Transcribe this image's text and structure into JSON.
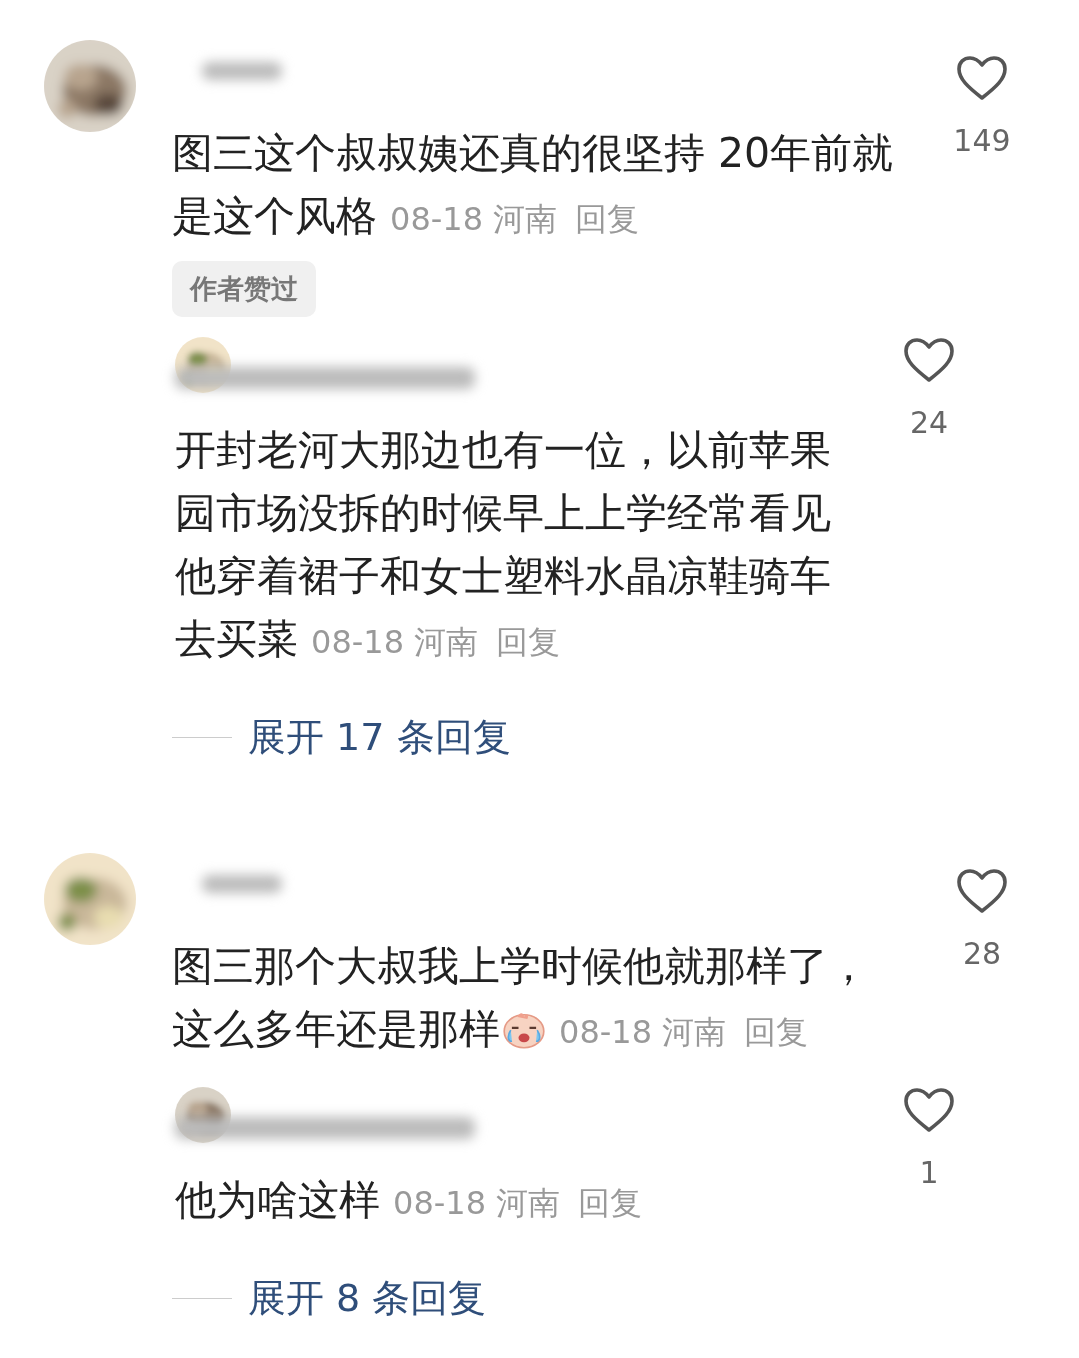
{
  "comments": [
    {
      "text": "图三这个叔叔姨还真的很坚持  20年前就是这个风格",
      "emoji": false,
      "date": "08-18",
      "location": "河南",
      "reply_label": "回复",
      "badge": "作者赞过",
      "likes": "149",
      "replies": [
        {
          "text": "开封老河大那边也有一位，以前苹果园市场没拆的时候早上上学经常看见他穿着裙子和女士塑料水晶凉鞋骑车去买菜",
          "date": "08-18",
          "location": "河南",
          "reply_label": "回复",
          "likes": "24"
        }
      ],
      "expand_label": "展开 17 条回复"
    },
    {
      "text": "图三那个大叔我上学时候他就那样了，这么多年还是那样",
      "emoji": true,
      "date": "08-18",
      "location": "河南",
      "reply_label": "回复",
      "likes": "28",
      "replies": [
        {
          "text": "他为啥这样",
          "date": "08-18",
          "location": "河南",
          "reply_label": "回复",
          "likes": "1"
        }
      ],
      "expand_label": "展开 8 条回复"
    }
  ]
}
